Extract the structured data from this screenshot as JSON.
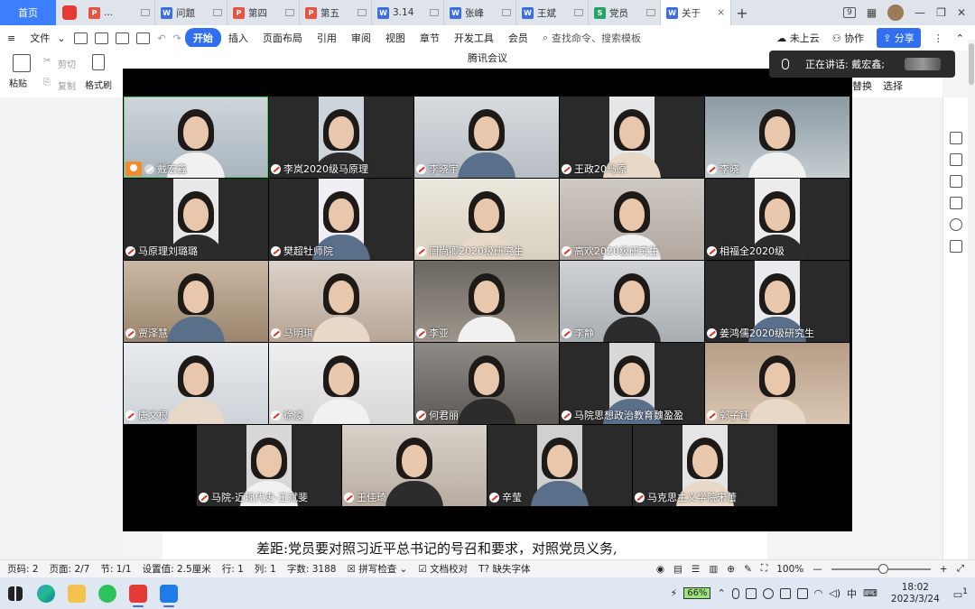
{
  "tabbar": {
    "home": "首页",
    "tabs": [
      {
        "label": "...",
        "icon": "red"
      },
      {
        "label": "问题",
        "icon": "blue"
      },
      {
        "label": "第四",
        "icon": "red"
      },
      {
        "label": "第五",
        "icon": "red"
      },
      {
        "label": "3.14",
        "icon": "blue"
      },
      {
        "label": "张峰",
        "icon": "blue"
      },
      {
        "label": "王斌",
        "icon": "blue"
      },
      {
        "label": "党员",
        "icon": "green"
      },
      {
        "label": "关于",
        "icon": "blue"
      }
    ],
    "box_badge": "9"
  },
  "menubar": {
    "file": "文件",
    "items": [
      "开始",
      "插入",
      "页面布局",
      "引用",
      "审阅",
      "视图",
      "章节",
      "开发工具",
      "会员"
    ],
    "search_placeholder": "查找命令、搜索模板",
    "cloud": "未上云",
    "collab": "协作",
    "share": "分享"
  },
  "toolbar": {
    "paste": "粘贴",
    "cut": "剪切",
    "copy": "复制",
    "format_painter": "格式刷",
    "replace": "替换",
    "select": "选择"
  },
  "meeting": {
    "title": "腾讯会议",
    "speaking_prefix": "正在讲话:",
    "speaking_name": "戴宏鑫;",
    "participants": [
      {
        "name": "戴宏鑫",
        "host": true
      },
      {
        "name": "李岚2020级马原理"
      },
      {
        "name": "李晓宇"
      },
      {
        "name": "王政20马原"
      },
      {
        "name": "李晓"
      },
      {
        "name": "马原理刘璐璐"
      },
      {
        "name": "樊超牡师院"
      },
      {
        "name": "闫尚卿2020级研究生"
      },
      {
        "name": "高欢2020级研究生"
      },
      {
        "name": "相福全2020级"
      },
      {
        "name": "贾泽慧"
      },
      {
        "name": "马明琪"
      },
      {
        "name": "李亚"
      },
      {
        "name": "李静"
      },
      {
        "name": "姜鸿儒2020级研究生"
      },
      {
        "name": "唐文根"
      },
      {
        "name": "徐凌"
      },
      {
        "name": "何君丽"
      },
      {
        "name": "马院思想政治教育魏盈盈"
      },
      {
        "name": "郭子钰"
      },
      {
        "name": "马院-近现代史-王斌斐"
      },
      {
        "name": "王佳琦"
      },
      {
        "name": "辛莹"
      },
      {
        "name": "马克思主义学院宋蕾"
      }
    ]
  },
  "document": {
    "text": "差距:党员要对照习近平总书记的号召和要求，对照党员义务,"
  },
  "statusbar": {
    "page_no": "页码: 2",
    "pages": "页面: 2/7",
    "section": "节: 1/1",
    "setting": "设置值: 2.5厘米",
    "row": "行: 1",
    "col": "列: 1",
    "words": "字数: 3188",
    "spell": "拼写检查",
    "proof": "文档校对",
    "missing_font": "缺失字体",
    "zoom": "100%"
  },
  "taskbar": {
    "battery": "66%",
    "ime": "中",
    "time": "18:02",
    "date": "2023/3/24",
    "notifications": "1"
  },
  "colors": {
    "accent": "#2f6ff0",
    "home_tab": "#3d7eff",
    "meeting_bg": "#000000",
    "host_badge": "#f28c28"
  }
}
